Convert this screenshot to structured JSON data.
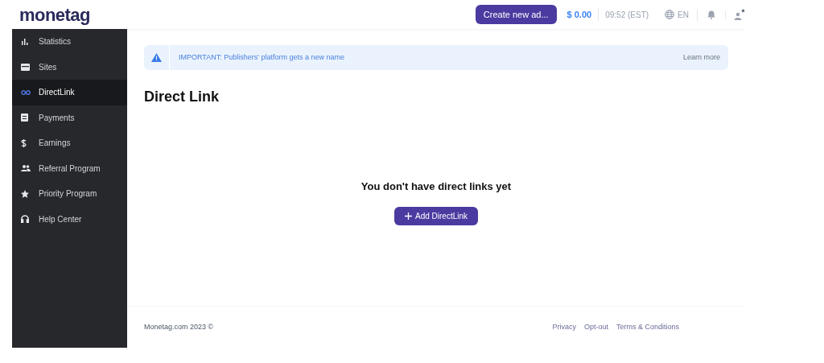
{
  "logo": "monetag",
  "header": {
    "create_button": "Create new ad...",
    "balance": "$ 0.00",
    "time": "09:52 (EST)",
    "language": "EN"
  },
  "sidebar": {
    "items": [
      {
        "label": "Statistics",
        "selected": false
      },
      {
        "label": "Sites",
        "selected": false
      },
      {
        "label": "DirectLink",
        "selected": true
      },
      {
        "label": "Payments",
        "selected": false
      },
      {
        "label": "Earnings",
        "selected": false
      },
      {
        "label": "Referral Program",
        "selected": false
      },
      {
        "label": "Priority Program",
        "selected": false
      },
      {
        "label": "Help Center",
        "selected": false
      }
    ]
  },
  "notice": {
    "text": "IMPORTANT: Publishers' platform gets a new name",
    "link": "Learn more"
  },
  "page_title": "Direct Link",
  "empty_state": {
    "message": "You don't have direct links yet",
    "button": "Add DirectLink"
  },
  "footer": {
    "copyright": "Monetag.com 2023 ©",
    "links": [
      "Privacy",
      "Opt-out",
      "Terms & Conditions"
    ]
  }
}
